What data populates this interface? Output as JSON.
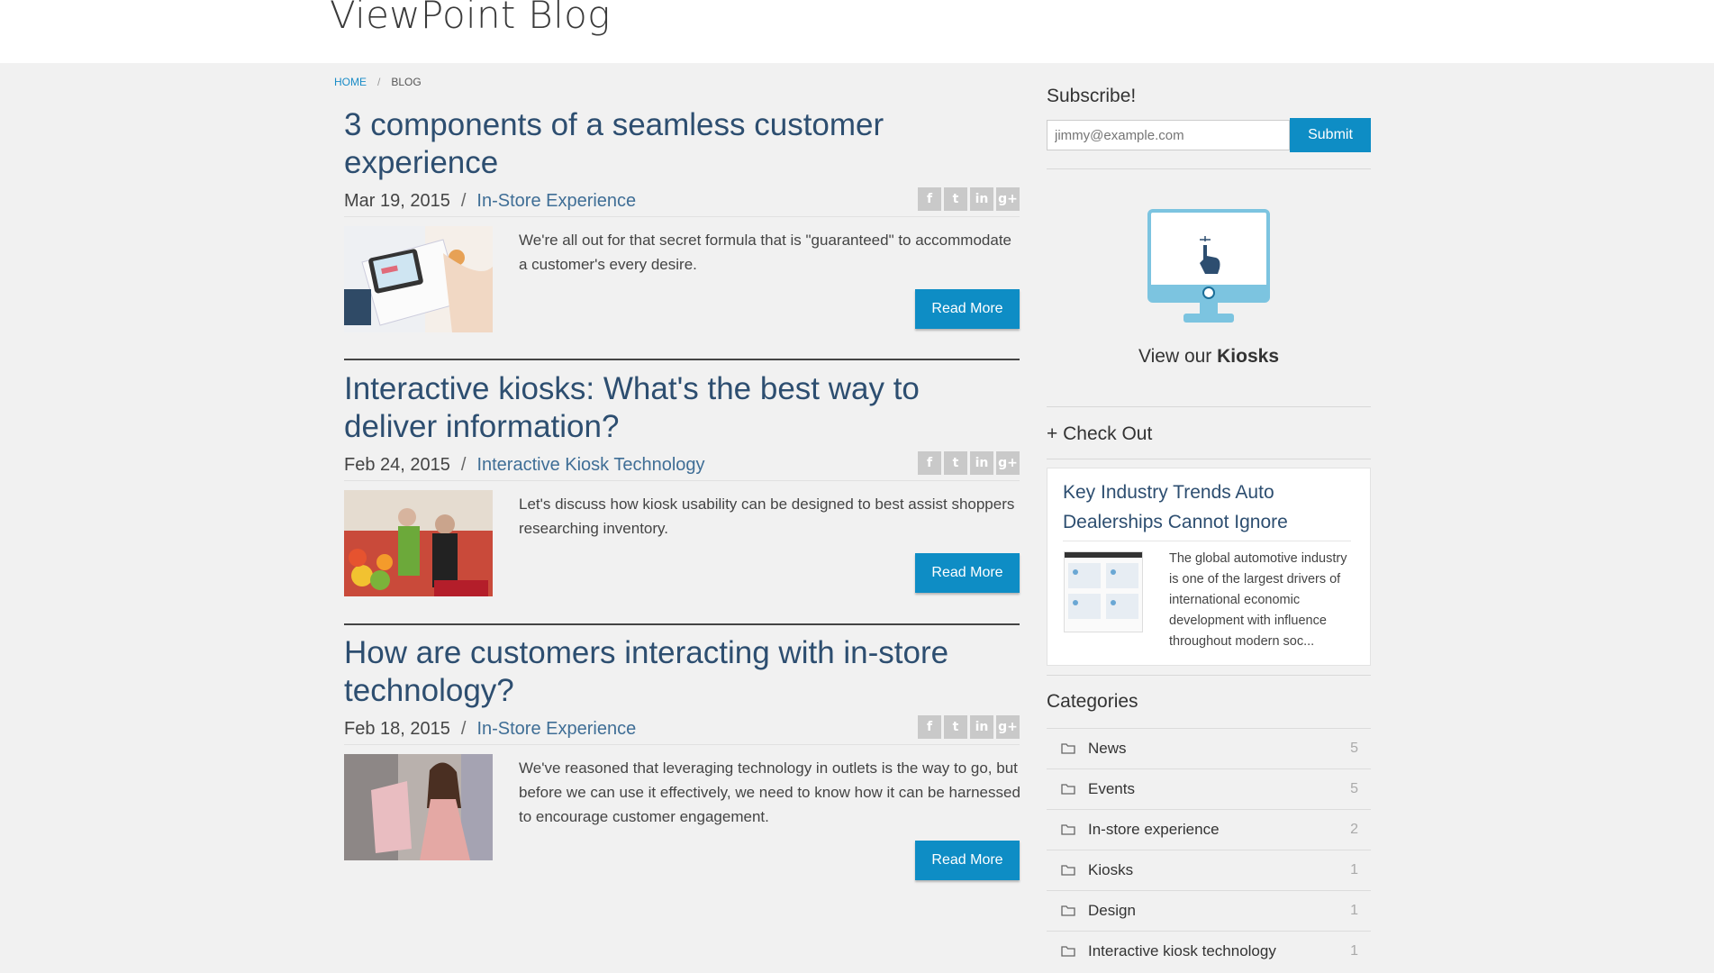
{
  "header": {
    "site_title": "ViewPoint Blog"
  },
  "breadcrumb": {
    "home": "HOME",
    "separator": "/",
    "current": "BLOG"
  },
  "posts": [
    {
      "title": "3 components of a seamless customer experience",
      "date": "Mar 19, 2015",
      "category": "In-Store Experience",
      "excerpt": "We're all out for that secret formula that is \"guaranteed\" to accommodate a customer's every desire.",
      "read_more": "Read More"
    },
    {
      "title": "Interactive kiosks: What's the best way to deliver information?",
      "date": "Feb 24, 2015",
      "category": "Interactive Kiosk Technology",
      "excerpt": "Let's discuss how kiosk usability can be designed to best assist shoppers researching inventory.",
      "read_more": "Read More"
    },
    {
      "title": "How are customers interacting with in-store technology?",
      "date": "Feb 18, 2015",
      "category": "In-Store Experience",
      "excerpt": "We've reasoned that leveraging technology in outlets is the way to go, but before we can use it effectively, we need to know how it can be harnessed to encourage customer engagement.",
      "read_more": "Read More"
    }
  ],
  "share_icons": [
    "f",
    "t",
    "in",
    "g+"
  ],
  "sidebar": {
    "subscribe": {
      "title": "Subscribe!",
      "placeholder": "jimmy@example.com",
      "button": "Submit"
    },
    "kiosk": {
      "prefix": "View our ",
      "bold": "Kiosks"
    },
    "check_out": {
      "title": "+ Check Out",
      "card_title": "Key Industry Trends Auto Dealerships Cannot Ignore",
      "card_text": "The global automotive industry is one of the largest drivers of international economic development with influence throughout modern soc..."
    },
    "categories": {
      "title": "Categories",
      "items": [
        {
          "name": "News",
          "count": "5"
        },
        {
          "name": "Events",
          "count": "5"
        },
        {
          "name": "In-store experience",
          "count": "2"
        },
        {
          "name": "Kiosks",
          "count": "1"
        },
        {
          "name": "Design",
          "count": "1"
        },
        {
          "name": "Interactive kiosk technology",
          "count": "1"
        }
      ]
    }
  },
  "colors": {
    "accent": "#0e8dc5",
    "title_blue": "#2d4e70",
    "link": "#3f6e96"
  }
}
